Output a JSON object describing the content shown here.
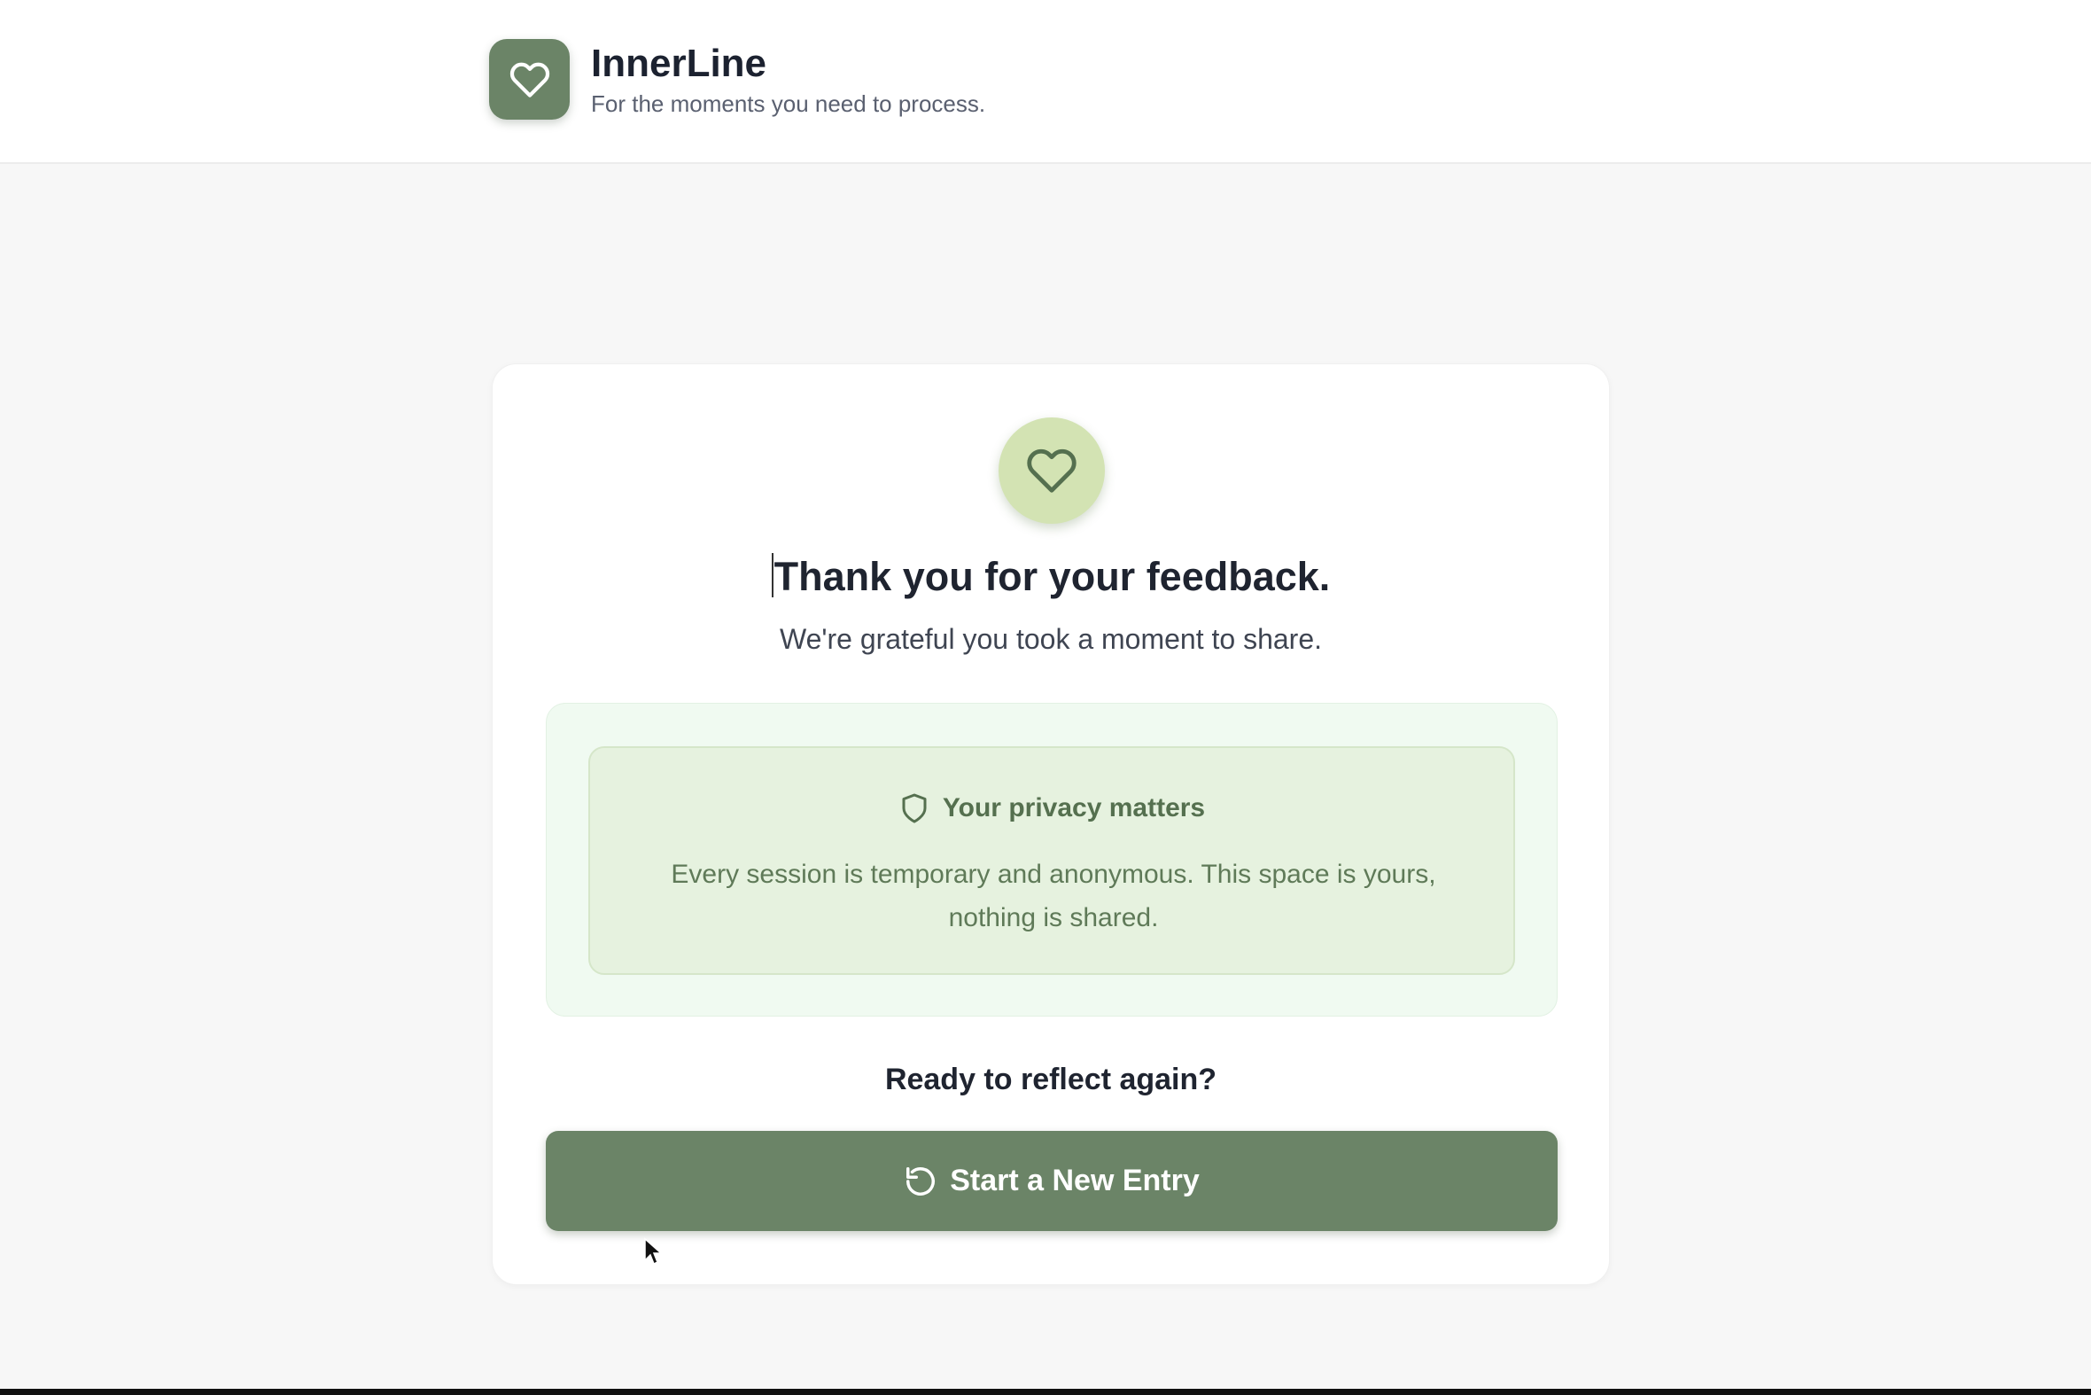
{
  "header": {
    "app_name": "InnerLine",
    "tagline": "For the moments you need to process."
  },
  "confirmation": {
    "title": "Thank you for your feedback.",
    "subtitle": "We're grateful you took a moment to share."
  },
  "privacy": {
    "title": "Your privacy matters",
    "body": "Every session is temporary and anonymous. This space is yours, nothing is shared."
  },
  "cta": {
    "prompt": "Ready to reflect again?",
    "button_label": "Start a New Entry"
  },
  "icons": {
    "logo": "heart-icon",
    "confirmation": "heart-icon",
    "privacy": "shield-icon",
    "button": "refresh-icon"
  },
  "colors": {
    "brand": "#6b8467",
    "heart_circle": "#d3e3b3",
    "privacy_bg": "#e6f2df",
    "privacy_text": "#5f7a58"
  }
}
